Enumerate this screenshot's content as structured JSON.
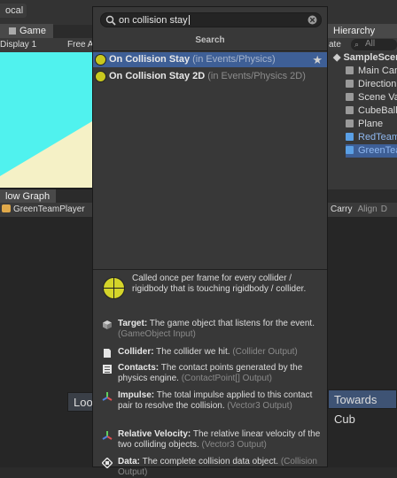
{
  "editor": {
    "top_tab_local": "ocal",
    "game_tab": "Game",
    "display": "Display 1",
    "free_aspect": "Free A",
    "hierarchy_tab": "Hierarchy",
    "hierarchy_filter": "All",
    "create_fragment": "ate",
    "graph_tab": "low Graph",
    "graph_breadcrumb": "GreenTeamPlayer",
    "graph_toolbar": [
      "Carry",
      "Align",
      "D"
    ],
    "scene_name": "SampleScen",
    "hierarchy_items": [
      {
        "label": "Main Can",
        "icon": "gameobject-icon"
      },
      {
        "label": "Direction",
        "icon": "gameobject-icon"
      },
      {
        "label": "Scene Va",
        "icon": "gameobject-icon"
      },
      {
        "label": "CubeBall",
        "icon": "gameobject-icon"
      },
      {
        "label": "Plane",
        "icon": "gameobject-icon"
      },
      {
        "label": "RedTeam",
        "icon": "prefab-icon"
      },
      {
        "label": "GreenTea",
        "icon": "prefab-icon"
      }
    ],
    "node_left": "Loo",
    "node_right": "Towards Cub"
  },
  "popup": {
    "search_value": "on collision stay",
    "search_title": "Search",
    "results": [
      {
        "name": "On Collision Stay",
        "path": " (in Events/Physics)",
        "selected": true,
        "favorite": true
      },
      {
        "name": "On Collision Stay 2D",
        "path": " (in Events/Physics 2D)",
        "selected": false,
        "favorite": false
      }
    ],
    "description": "Called once per frame for every collider / rigidbody that is touching rigidbody / collider.",
    "ports": [
      {
        "name": "Target:",
        "text": " The game object that listens for the event. ",
        "type": "(GameObject Input)",
        "icon": "gameobject-icon"
      },
      {
        "name": "Collider:",
        "text": " The collider we hit. ",
        "type": "(Collider Output)",
        "icon": "document-icon"
      },
      {
        "name": "Contacts:",
        "text": " The contact points generated by the physics engine. ",
        "type": "(ContactPoint[] Output)",
        "icon": "list-icon"
      },
      {
        "name": "Impulse:",
        "text": " The total impulse applied to this contact pair to resolve the collision. ",
        "type": "(Vector3 Output)",
        "icon": "vector-axes-icon"
      },
      {
        "name": "Relative Velocity:",
        "text": " The relative linear velocity of the two colliding objects. ",
        "type": "(Vector3 Output)",
        "icon": "vector-axes-icon"
      },
      {
        "name": "Data:",
        "text": " The complete collision data object. ",
        "type": "(Collision Output)",
        "icon": "collision-data-icon"
      }
    ]
  },
  "colors": {
    "selection": "#3e5f96",
    "event_icon": "#c8c81e",
    "game_view": "#4ff5f0"
  }
}
